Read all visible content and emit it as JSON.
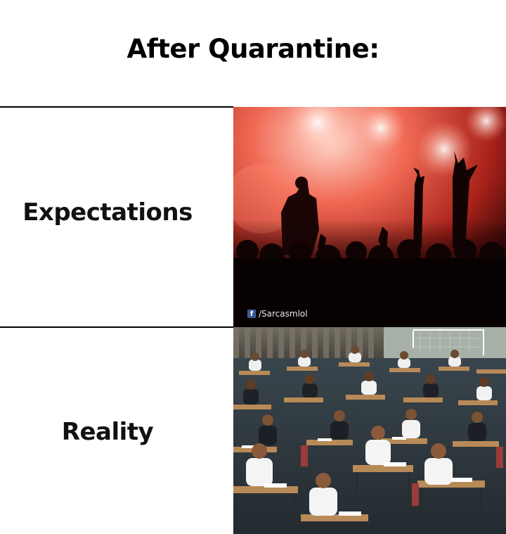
{
  "meme": {
    "title": "After Quarantine:",
    "rows": [
      {
        "label": "Expectations",
        "image": "concert-crowd-photo"
      },
      {
        "label": "Reality",
        "image": "exam-hall-photo"
      }
    ],
    "watermark": {
      "icon": "facebook-icon",
      "text": "/Sarcasmlol"
    }
  }
}
